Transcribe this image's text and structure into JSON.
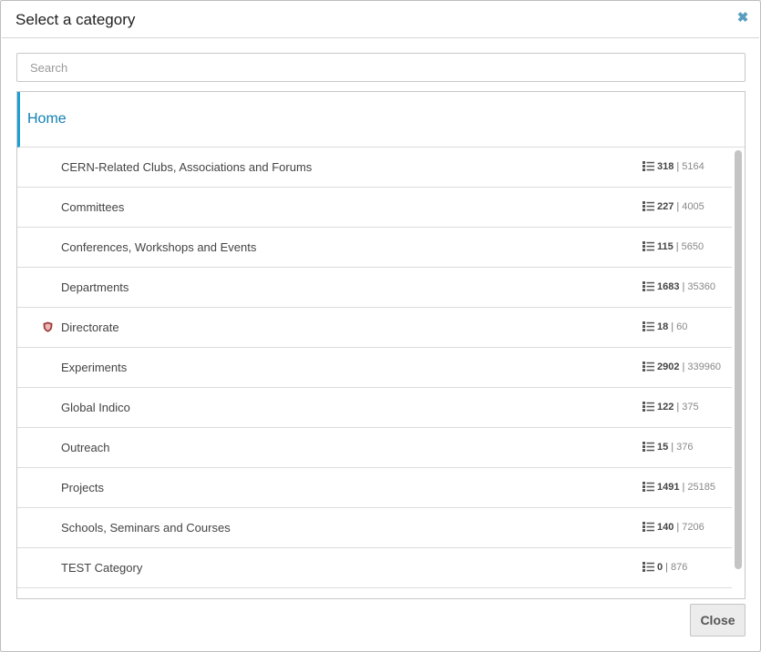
{
  "dialog": {
    "title": "Select a category",
    "close_icon": "close-icon",
    "close_button_label": "Close"
  },
  "search": {
    "placeholder": "Search",
    "value": ""
  },
  "tree": {
    "home_label": "Home",
    "items": [
      {
        "label": "CERN-Related Clubs, Associations and Forums",
        "categories": "318",
        "events": "5164",
        "protected": false
      },
      {
        "label": "Committees",
        "categories": "227",
        "events": "4005",
        "protected": false
      },
      {
        "label": "Conferences, Workshops and Events",
        "categories": "115",
        "events": "5650",
        "protected": false
      },
      {
        "label": "Departments",
        "categories": "1683",
        "events": "35360",
        "protected": false
      },
      {
        "label": "Directorate",
        "categories": "18",
        "events": "60",
        "protected": true
      },
      {
        "label": "Experiments",
        "categories": "2902",
        "events": "339960",
        "protected": false
      },
      {
        "label": "Global Indico",
        "categories": "122",
        "events": "375",
        "protected": false
      },
      {
        "label": "Outreach",
        "categories": "15",
        "events": "376",
        "protected": false
      },
      {
        "label": "Projects",
        "categories": "1491",
        "events": "25185",
        "protected": false
      },
      {
        "label": "Schools, Seminars and Courses",
        "categories": "140",
        "events": "7206",
        "protected": false
      },
      {
        "label": "TEST Category",
        "categories": "0",
        "events": "876",
        "protected": false
      }
    ],
    "separator": "|",
    "list_icon": "list-icon",
    "protected_icon": "shield-icon"
  },
  "colors": {
    "accent": "#1d9fd6",
    "home_text": "#0f7fb4",
    "protected": "#a03a3a"
  }
}
